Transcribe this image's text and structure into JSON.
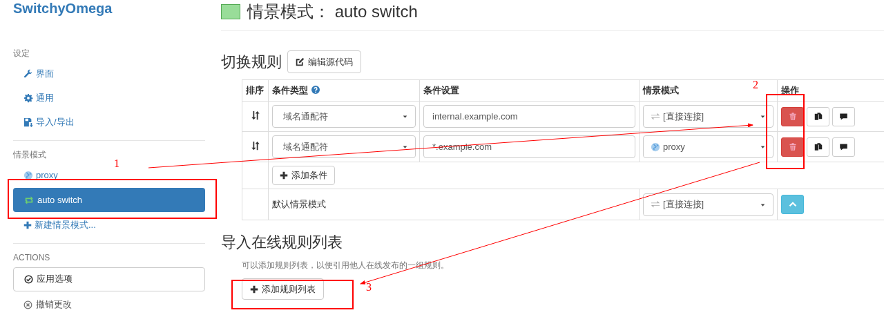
{
  "sidebar": {
    "logo": "SwitchyOmega",
    "sections": [
      {
        "heading": "设定",
        "items": [
          {
            "label": "界面",
            "selected": false
          },
          {
            "label": "通用",
            "selected": false
          },
          {
            "label": "导入/导出",
            "selected": false
          }
        ]
      },
      {
        "heading": "情景模式",
        "items": [
          {
            "label": "proxy",
            "selected": false
          },
          {
            "label": "auto switch",
            "selected": true
          },
          {
            "label": "新建情景模式...",
            "selected": false
          }
        ]
      }
    ],
    "actions": {
      "heading": "ACTIONS",
      "buttons": [
        {
          "label": "应用选项",
          "kind": "bordered"
        },
        {
          "label": "撤销更改",
          "kind": "plain"
        }
      ]
    }
  },
  "main": {
    "title": "情景模式： auto switch",
    "rules": {
      "heading": "切换规则",
      "edit_button": "编辑源代码",
      "columns": [
        "排序",
        "条件类型",
        "条件设置",
        "情景模式",
        "操作"
      ],
      "rows": [
        {
          "condition_type": "域名通配符",
          "condition": "internal.example.com",
          "profile": {
            "label": "[直接连接]",
            "kind": "direct"
          }
        },
        {
          "condition_type": "域名通配符",
          "condition": "*.example.com",
          "profile": {
            "label": "proxy",
            "kind": "proxy"
          }
        }
      ],
      "add_button": "添加条件",
      "default_label": "默认情景模式",
      "default_profile": {
        "label": "[直接连接]",
        "kind": "direct"
      }
    },
    "import": {
      "heading": "导入在线规则列表",
      "help": "可以添加规则列表，以便引用他人在线发布的一组规则。",
      "add_button": "添加规则列表"
    }
  },
  "annotations": [
    {
      "label": "1"
    },
    {
      "label": "2"
    },
    {
      "label": "3"
    }
  ]
}
